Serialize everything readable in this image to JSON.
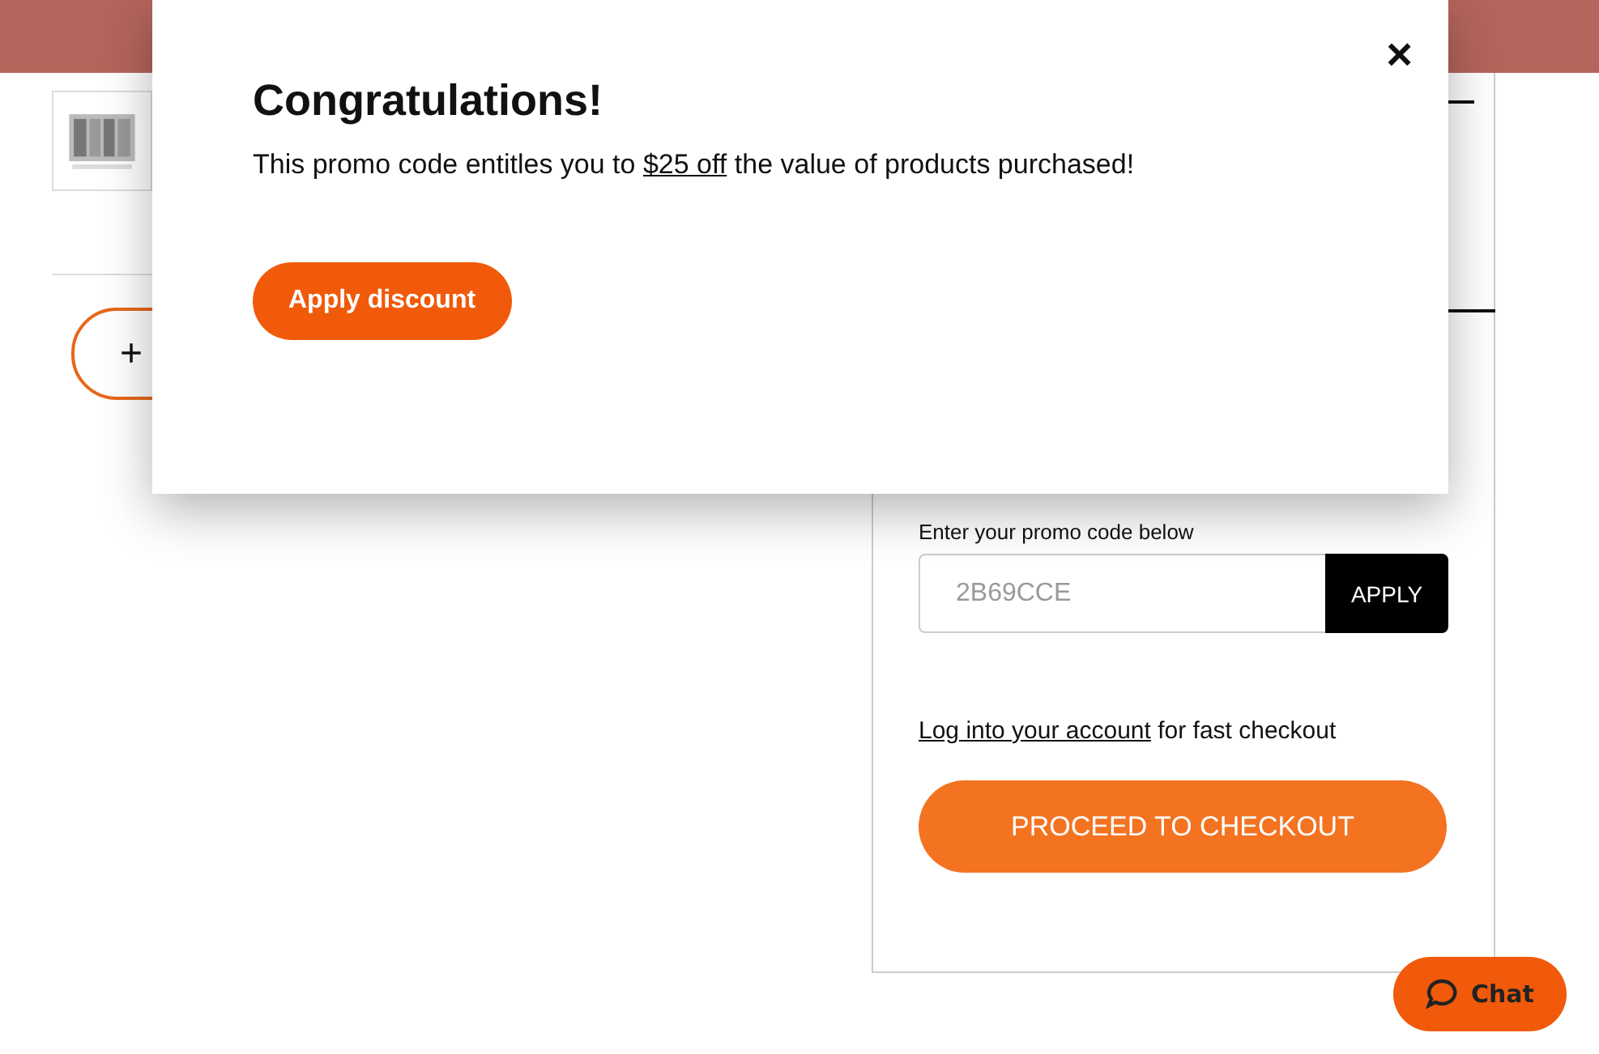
{
  "quantity_button": {
    "label": "+"
  },
  "promo": {
    "label": "Enter your promo code below",
    "placeholder": "2B69CCE",
    "button": "APPLY"
  },
  "login": {
    "link": "Log into your account",
    "text": "for fast checkout"
  },
  "checkout_button": "PROCEED TO CHECKOUT",
  "chat_button": "Chat",
  "modal": {
    "close": "×",
    "title": "Congratulations!",
    "message": "This promo code entitles you to",
    "link": "$25 off",
    "message_end": "the value of products purchased!",
    "button": "Apply discount"
  }
}
